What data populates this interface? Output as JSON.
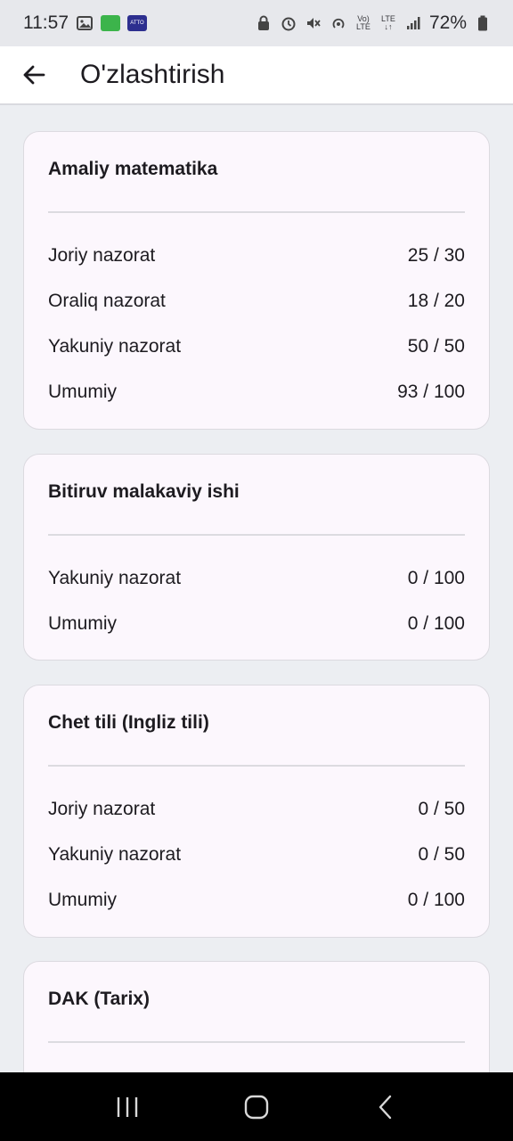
{
  "status_bar": {
    "time": "11:57",
    "badge1": "",
    "badge2": "ATTO",
    "battery": "72%"
  },
  "app_bar": {
    "title": "O'zlashtirish"
  },
  "subjects": [
    {
      "name": "Amaliy matematika",
      "rows": [
        {
          "label": "Joriy nazorat",
          "value": "25 / 30"
        },
        {
          "label": "Oraliq nazorat",
          "value": "18 / 20"
        },
        {
          "label": "Yakuniy nazorat",
          "value": "50 / 50"
        },
        {
          "label": "Umumiy",
          "value": "93 / 100"
        }
      ]
    },
    {
      "name": "Bitiruv malakaviy ishi",
      "rows": [
        {
          "label": "Yakuniy nazorat",
          "value": "0 / 100"
        },
        {
          "label": "Umumiy",
          "value": "0 / 100"
        }
      ]
    },
    {
      "name": "Chet tili (Ingliz tili)",
      "rows": [
        {
          "label": "Joriy nazorat",
          "value": "0 / 50"
        },
        {
          "label": "Yakuniy nazorat",
          "value": "0 / 50"
        },
        {
          "label": "Umumiy",
          "value": "0 / 100"
        }
      ]
    },
    {
      "name": "DAK (Tarix)",
      "rows": []
    }
  ],
  "colors": {
    "background": "#eceef2",
    "card": "#fcf7fd",
    "text": "#1d1b20"
  }
}
